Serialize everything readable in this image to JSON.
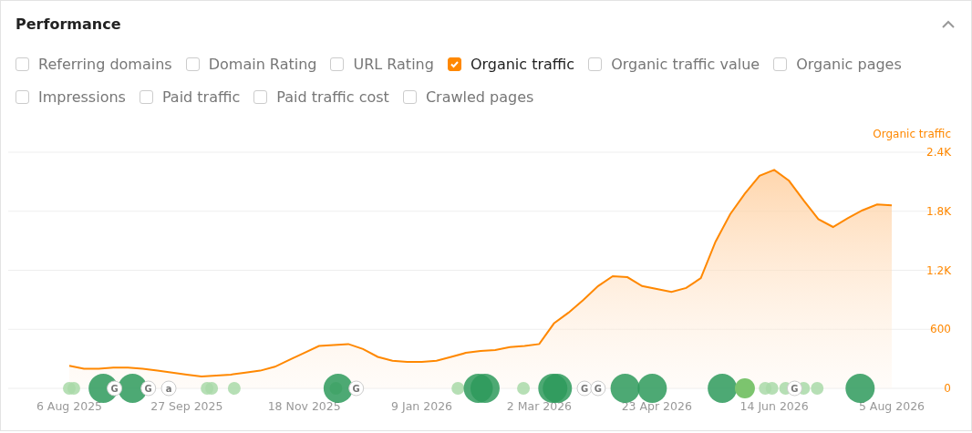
{
  "panel": {
    "title": "Performance",
    "expanded": true
  },
  "metrics": [
    {
      "label": "Referring domains",
      "checked": false
    },
    {
      "label": "Domain Rating",
      "checked": false
    },
    {
      "label": "URL Rating",
      "checked": false
    },
    {
      "label": "Organic traffic",
      "checked": true
    },
    {
      "label": "Organic traffic value",
      "checked": false
    },
    {
      "label": "Organic pages",
      "checked": false
    },
    {
      "label": "Impressions",
      "checked": false
    },
    {
      "label": "Paid traffic",
      "checked": false
    },
    {
      "label": "Paid traffic cost",
      "checked": false
    },
    {
      "label": "Crawled pages",
      "checked": false
    }
  ],
  "chart": {
    "chart_data": {
      "type": "area",
      "categories": [
        "6 Aug 2025",
        null,
        null,
        null,
        null,
        null,
        null,
        null,
        "27 Sep 2025",
        null,
        null,
        null,
        null,
        null,
        null,
        null,
        "18 Nov 2025",
        null,
        null,
        null,
        null,
        null,
        null,
        null,
        "9 Jan 2026",
        null,
        null,
        null,
        null,
        null,
        null,
        null,
        "2 Mar 2026",
        null,
        null,
        null,
        null,
        null,
        null,
        null,
        "23 Apr 2026",
        null,
        null,
        null,
        null,
        null,
        null,
        null,
        "14 Jun 2026",
        null,
        null,
        null,
        null,
        null,
        null,
        null,
        "5 Aug 2026"
      ],
      "series": [
        {
          "name": "Organic traffic",
          "color": "#ff8800",
          "values": [
            230,
            200,
            200,
            210,
            210,
            200,
            180,
            160,
            140,
            120,
            130,
            140,
            160,
            180,
            220,
            290,
            360,
            430,
            440,
            450,
            400,
            320,
            280,
            270,
            270,
            280,
            320,
            360,
            380,
            390,
            420,
            430,
            450,
            660,
            770,
            900,
            1040,
            1140,
            1130,
            1040,
            1010,
            980,
            1020,
            1120,
            1490,
            1770,
            1980,
            2160,
            2220,
            2110,
            1910,
            1720,
            1640,
            1730,
            1810,
            1870,
            1860
          ]
        }
      ],
      "ylim": [
        0,
        2400
      ],
      "yticks": [
        {
          "value": 0,
          "label": "0"
        },
        {
          "value": 600,
          "label": "600"
        },
        {
          "value": 1200,
          "label": "1.2K"
        },
        {
          "value": 1800,
          "label": "1.8K"
        },
        {
          "value": 2400,
          "label": "2.4K"
        }
      ],
      "grid": true
    },
    "update_badges": [
      {
        "text": "G"
      },
      {
        "text": "G"
      },
      {
        "text": "a"
      },
      {
        "text": "G"
      },
      {
        "text": "G"
      },
      {
        "text": "G"
      },
      {
        "text": "G"
      }
    ]
  }
}
